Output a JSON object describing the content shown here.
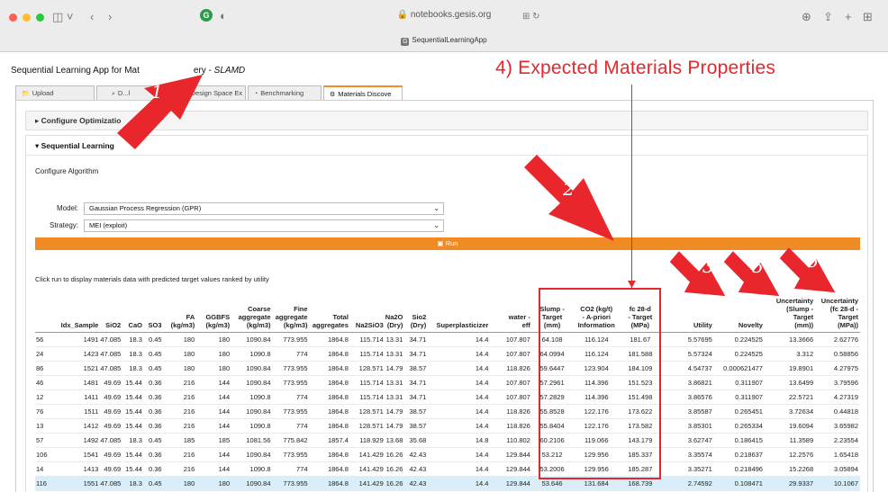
{
  "browser": {
    "url": "notebooks.gesis.org",
    "tab_title": "SequentialLearningApp"
  },
  "app": {
    "title_prefix": "Sequential Learning App for Mat",
    "title_mid": "ery - ",
    "title_italic": "SLAMD"
  },
  "tabs": [
    {
      "label": "Upload",
      "icon": "folder-icon"
    },
    {
      "label": "D...l",
      "icon": "search-icon"
    },
    {
      "label": "Design Space Ex",
      "icon": "grid-icon"
    },
    {
      "label": "Benchmarking",
      "icon": "gauge-icon"
    },
    {
      "label": "Materials Discove",
      "icon": "gear-icon"
    }
  ],
  "accordion": {
    "configure_optimization": "Configure Optimizatio",
    "sequential_learning": "Sequential Learning"
  },
  "config": {
    "heading": "Configure Algorithm",
    "model_label": "Model:",
    "model_value": "Gaussian Process Regression (GPR)",
    "strategy_label": "Strategy:",
    "strategy_value": "MEI (exploit)",
    "run_label": "Run"
  },
  "hint": "Click run to display materials data with predicted target values ranked by utility",
  "annotations": {
    "expected_properties": "4) Expected Materials Properties",
    "arrow_1": "1",
    "arrow_2": "2",
    "arrow_3": "3",
    "arrow_5": "5",
    "arrow_6": "6",
    "color": "#e8262b"
  },
  "table": {
    "columns": [
      [
        "",
        "",
        "Idx_Sample"
      ],
      [
        "",
        "",
        "SiO2"
      ],
      [
        "",
        "",
        "CaO"
      ],
      [
        "",
        "",
        "SO3"
      ],
      [
        "",
        "FA",
        "(kg/m3)"
      ],
      [
        "",
        "GGBFS",
        "(kg/m3)"
      ],
      [
        "Coarse",
        "aggregate",
        "(kg/m3)"
      ],
      [
        "Fine",
        "aggregate",
        "(kg/m3)"
      ],
      [
        "",
        "Total",
        "aggregates"
      ],
      [
        "",
        "",
        "Na2SiO3"
      ],
      [
        "",
        "Na2O",
        "(Dry)"
      ],
      [
        "",
        "Sio2",
        "(Dry)"
      ],
      [
        "",
        "",
        "Superplasticizer"
      ],
      [
        "",
        "water -",
        "eff"
      ],
      [
        "Slump -",
        "Target",
        "(mm)"
      ],
      [
        "CO2 (kg/t)",
        "- A-priori",
        "Information"
      ],
      [
        "fc 28-d",
        "- Target",
        "(MPa)"
      ],
      [
        "",
        "",
        ""
      ],
      [
        "",
        "",
        "Utility"
      ],
      [
        "",
        "",
        "Novelty"
      ],
      [
        "Uncertainty",
        "(Slump -",
        "Target",
        "(mm))"
      ],
      [
        "Uncertainty",
        "(fc 28-d -",
        "Target",
        "(MPa))"
      ]
    ],
    "rows": [
      [
        "56",
        "1491",
        "47.085",
        "18.3",
        "0.45",
        "180",
        "180",
        "1090.84",
        "773.955",
        "1864.8",
        "115.714",
        "13.31",
        "34.71",
        "14.4",
        "107.807",
        "64.108",
        "116.124",
        "181.67",
        "",
        "5.57695",
        "0.224525",
        "13.3666",
        "2.62776"
      ],
      [
        "24",
        "1423",
        "47.085",
        "18.3",
        "0.45",
        "180",
        "180",
        "1090.8",
        "774",
        "1864.8",
        "115.714",
        "13.31",
        "34.71",
        "14.4",
        "107.807",
        "64.0994",
        "116.124",
        "181.588",
        "",
        "5.57324",
        "0.224525",
        "3.312",
        "0.58856"
      ],
      [
        "86",
        "1521",
        "47.085",
        "18.3",
        "0.45",
        "180",
        "180",
        "1090.84",
        "773.955",
        "1864.8",
        "128.571",
        "14.79",
        "38.57",
        "14.4",
        "118.826",
        "59.6447",
        "123.904",
        "184.109",
        "",
        "4.54737",
        "0.000621477",
        "19.8901",
        "4.27975"
      ],
      [
        "46",
        "1481",
        "49.69",
        "15.44",
        "0.36",
        "216",
        "144",
        "1090.84",
        "773.955",
        "1864.8",
        "115.714",
        "13.31",
        "34.71",
        "14.4",
        "107.807",
        "57.2961",
        "114.396",
        "151.523",
        "",
        "3.86821",
        "0.311907",
        "13.6499",
        "3.79596"
      ],
      [
        "12",
        "1411",
        "49.69",
        "15.44",
        "0.36",
        "216",
        "144",
        "1090.8",
        "774",
        "1864.8",
        "115.714",
        "13.31",
        "34.71",
        "14.4",
        "107.807",
        "57.2829",
        "114.396",
        "151.498",
        "",
        "3.86576",
        "0.311907",
        "22.5721",
        "4.27319"
      ],
      [
        "76",
        "1511",
        "49.69",
        "15.44",
        "0.36",
        "216",
        "144",
        "1090.84",
        "773.955",
        "1864.8",
        "128.571",
        "14.79",
        "38.57",
        "14.4",
        "118.826",
        "55.8528",
        "122.176",
        "173.622",
        "",
        "3.85587",
        "0.265451",
        "3.72634",
        "0.44818"
      ],
      [
        "13",
        "1412",
        "49.69",
        "15.44",
        "0.36",
        "216",
        "144",
        "1090.8",
        "774",
        "1864.8",
        "128.571",
        "14.79",
        "38.57",
        "14.4",
        "118.826",
        "55.8404",
        "122.176",
        "173.582",
        "",
        "3.85301",
        "0.265334",
        "19.6094",
        "3.65982"
      ],
      [
        "57",
        "1492",
        "47.085",
        "18.3",
        "0.45",
        "185",
        "185",
        "1081.56",
        "775.842",
        "1857.4",
        "118.929",
        "13.68",
        "35.68",
        "14.8",
        "110.802",
        "60.2106",
        "119.066",
        "143.179",
        "",
        "3.62747",
        "0.186415",
        "11.3589",
        "2.23554"
      ],
      [
        "106",
        "1541",
        "49.69",
        "15.44",
        "0.36",
        "216",
        "144",
        "1090.84",
        "773.955",
        "1864.8",
        "141.429",
        "16.26",
        "42.43",
        "14.4",
        "129.844",
        "53.212",
        "129.956",
        "185.337",
        "",
        "3.35574",
        "0.218637",
        "12.2576",
        "1.65418"
      ],
      [
        "14",
        "1413",
        "49.69",
        "15.44",
        "0.36",
        "216",
        "144",
        "1090.8",
        "774",
        "1864.8",
        "141.429",
        "16.26",
        "42.43",
        "14.4",
        "129.844",
        "53.2006",
        "129.956",
        "185.287",
        "",
        "3.35271",
        "0.218496",
        "15.2268",
        "3.05894"
      ],
      [
        "116",
        "1551",
        "47.085",
        "18.3",
        "0.45",
        "180",
        "180",
        "1090.84",
        "773.955",
        "1864.8",
        "141.429",
        "16.26",
        "42.43",
        "14.4",
        "129.844",
        "53.646",
        "131.684",
        "168.739",
        "",
        "2.74592",
        "0.108471",
        "29.9337",
        "10.1067"
      ]
    ]
  }
}
